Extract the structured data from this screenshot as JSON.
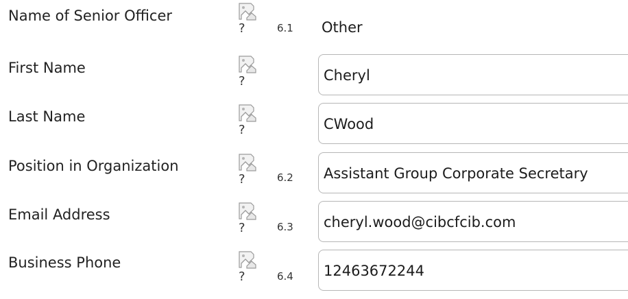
{
  "form": {
    "senior_officer": {
      "label": "Name of Senior Officer",
      "number": "6.1",
      "value": "Other",
      "help_glyph": "?"
    },
    "first_name": {
      "label": "First Name",
      "value": "Cheryl",
      "help_glyph": "?"
    },
    "last_name": {
      "label": "Last Name",
      "value": "CWood",
      "help_glyph": "?"
    },
    "position": {
      "label": "Position in Organization",
      "number": "6.2",
      "value": "Assistant Group Corporate Secretary",
      "help_glyph": "?"
    },
    "email": {
      "label": "Email Address",
      "number": "6.3",
      "value": "cheryl.wood@cibcfcib.com",
      "help_glyph": "?"
    },
    "phone": {
      "label": "Business Phone",
      "number": "6.4",
      "value": "12463672244",
      "help_glyph": "?"
    }
  },
  "icons": {
    "help_image": "broken-image-icon"
  }
}
